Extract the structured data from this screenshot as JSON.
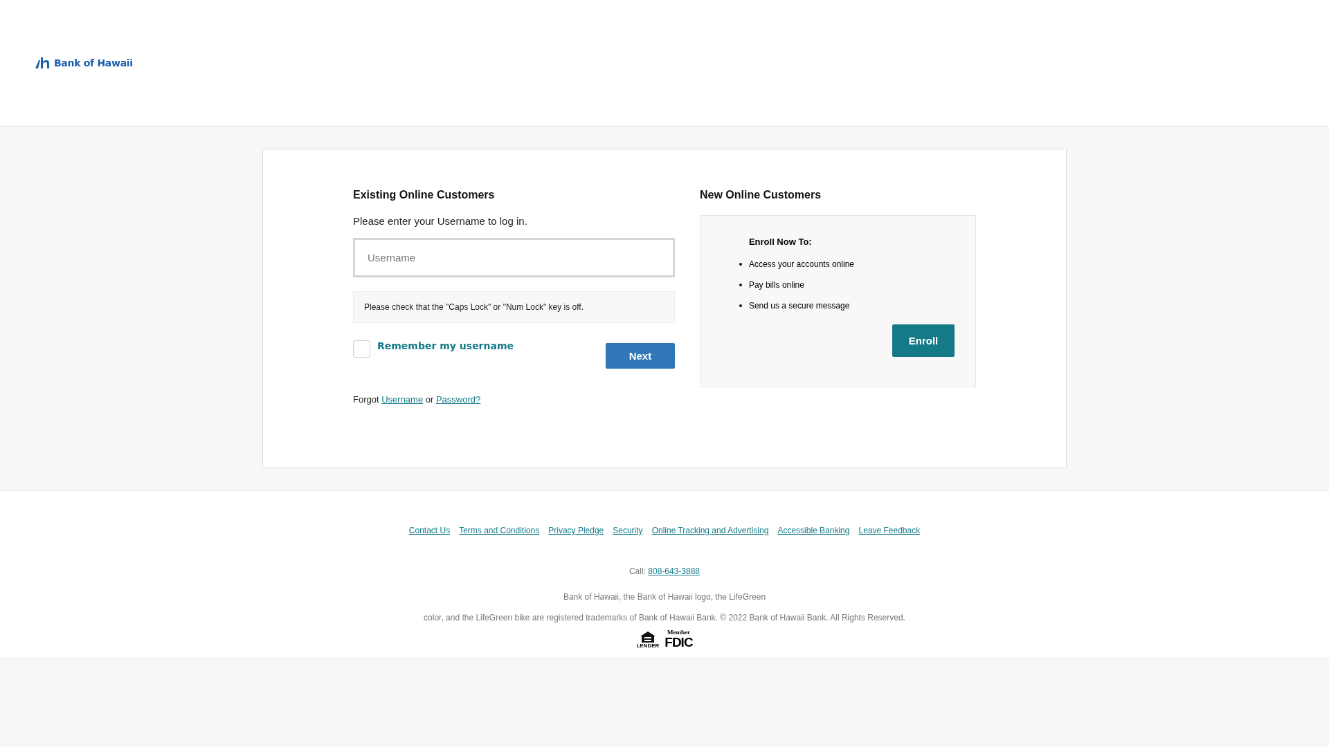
{
  "header": {
    "logo_text": "Bank of Hawaii"
  },
  "login": {
    "title": "Existing Online Customers",
    "prompt": "Please enter your Username to log in.",
    "username": {
      "placeholder": "Username"
    },
    "caps_notice": "Please check that the \"Caps Lock\" or \"Num Lock\" key is off.",
    "remember": {
      "label": "Remember my username",
      "checked": false
    },
    "next_button": "Next",
    "forgot": {
      "prefix": "Forgot",
      "username_link": "Username",
      "middle": "or",
      "password_link": "Password?"
    }
  },
  "enroll": {
    "title": "New Online Customers",
    "heading": "Enroll Now To:",
    "benefits": [
      "Access your accounts online",
      "Pay bills online",
      "Send us a secure message"
    ],
    "button": "Enroll"
  },
  "footer": {
    "links": [
      "Contact Us",
      "Terms and Conditions",
      "Privacy Pledge",
      "Security",
      "Online Tracking and Advertising",
      "Accessible Banking",
      "Leave Feedback"
    ],
    "call_label": "Call:",
    "phone": "808-643-3888",
    "legal": [
      "Bank of Hawaii, the Bank of Hawaii logo, the LifeGreen",
      "color, and the LifeGreen bike are registered trademarks of Bank of Hawaii Bank. © 2022 Bank of Hawaii Bank. All Rights Reserved."
    ],
    "lender_text": "LENDER",
    "fdic_member": "Member",
    "fdic": "FDIC"
  }
}
